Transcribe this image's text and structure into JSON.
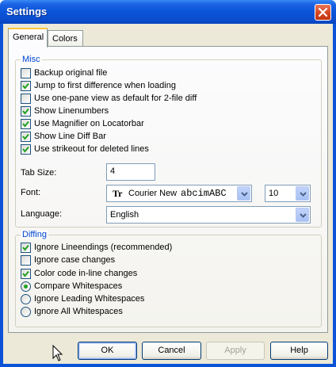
{
  "window": {
    "title": "Settings"
  },
  "tabs": [
    {
      "label": "General",
      "active": true
    },
    {
      "label": "Colors",
      "active": false
    }
  ],
  "misc": {
    "label": "Misc",
    "options": [
      {
        "label": "Backup original file",
        "checked": false
      },
      {
        "label": "Jump to first difference when loading",
        "checked": true
      },
      {
        "label": "Use one-pane view as default for 2-file diff",
        "checked": false
      },
      {
        "label": "Show Linenumbers",
        "checked": true
      },
      {
        "label": "Use Magnifier on Locatorbar",
        "checked": true
      },
      {
        "label": "Show Line Diff Bar",
        "checked": true
      },
      {
        "label": "Use strikeout for deleted lines",
        "checked": true
      }
    ],
    "tab_size_label": "Tab Size:",
    "tab_size_value": "4",
    "font_label": "Font:",
    "font_glyph": "Tr",
    "font_name": "Courier New",
    "font_sample": "abcimABC",
    "font_size": "10",
    "language_label": "Language:",
    "language_value": "English"
  },
  "diffing": {
    "label": "Diffing",
    "checks": [
      {
        "label": "Ignore Lineendings (recommended)",
        "checked": true
      },
      {
        "label": "Ignore case changes",
        "checked": false
      },
      {
        "label": "Color code in-line changes",
        "checked": true
      }
    ],
    "whitespace": [
      {
        "label": "Compare Whitespaces",
        "selected": true
      },
      {
        "label": "Ignore Leading Whitespaces",
        "selected": false
      },
      {
        "label": "Ignore All Whitespaces",
        "selected": false
      }
    ]
  },
  "buttons": {
    "ok": "OK",
    "cancel": "Cancel",
    "apply": "Apply",
    "help": "Help"
  },
  "colors": {
    "title_bar": "#0a54d9",
    "group_label": "#0046d5",
    "check_mark": "#21a121",
    "dialog_bg": "#ece9d8"
  }
}
